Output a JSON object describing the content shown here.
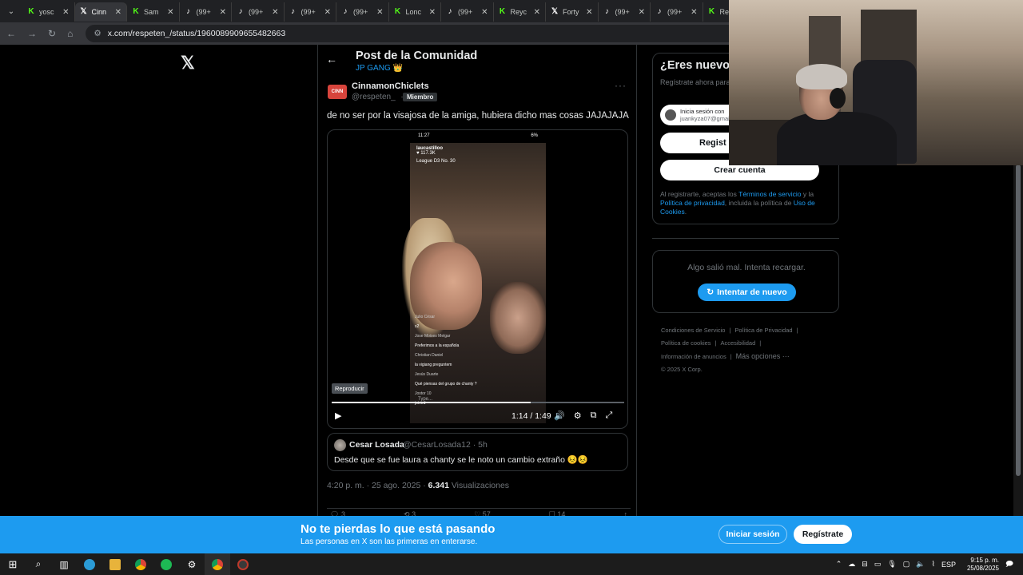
{
  "browser": {
    "tabs": [
      {
        "favicon": "K",
        "favicon_color": "#53fc18",
        "title": "yosc",
        "active": false
      },
      {
        "favicon": "𝕏",
        "favicon_color": "#ffffff",
        "title": "Cinn",
        "active": true
      },
      {
        "favicon": "K",
        "favicon_color": "#53fc18",
        "title": "Sam",
        "active": false
      },
      {
        "favicon": "♪",
        "favicon_color": "#ffffff",
        "title": "(99+",
        "active": false
      },
      {
        "favicon": "♪",
        "favicon_color": "#ffffff",
        "title": "(99+",
        "active": false
      },
      {
        "favicon": "♪",
        "favicon_color": "#ffffff",
        "title": "(99+",
        "active": false
      },
      {
        "favicon": "♪",
        "favicon_color": "#ffffff",
        "title": "(99+",
        "active": false
      },
      {
        "favicon": "K",
        "favicon_color": "#53fc18",
        "title": "Lonc",
        "active": false
      },
      {
        "favicon": "♪",
        "favicon_color": "#ffffff",
        "title": "(99+",
        "active": false
      },
      {
        "favicon": "K",
        "favicon_color": "#53fc18",
        "title": "Reyc",
        "active": false
      },
      {
        "favicon": "𝕏",
        "favicon_color": "#ffffff",
        "title": "Forty",
        "active": false
      },
      {
        "favicon": "♪",
        "favicon_color": "#ffffff",
        "title": "(99+",
        "active": false
      },
      {
        "favicon": "♪",
        "favicon_color": "#ffffff",
        "title": "(99+",
        "active": false
      },
      {
        "favicon": "K",
        "favicon_color": "#53fc18",
        "title": "Reyc",
        "active": false
      }
    ],
    "url": "x.com/respeten_/status/1960089909655482663"
  },
  "header": {
    "title": "Post de la Comunidad",
    "community": "JP GANG 👑"
  },
  "post": {
    "author_name": "CinnamonChiclets",
    "author_handle": "@respeten_",
    "separator": "·",
    "member_badge": "Miembro",
    "text": "de no ser por la visajosa de la amiga, hubiera dicho mas cosas JAJAJAJA",
    "video": {
      "tooltip": "Reproducir",
      "time": "1:14 / 1:49",
      "progress": 0.68,
      "phone_time": "11:27",
      "phone_battery": "6%",
      "live_host": "laucastilloo",
      "live_viewers": "♥ 117.3K",
      "live_rank": "League D3 No. 30",
      "chat": [
        {
          "user": "Julio César",
          "msg": "x2"
        },
        {
          "user": "Jose Moises Melgar",
          "msg": "Preferimos a la española"
        },
        {
          "user": "Christian Daniel",
          "msg": "la vigiang preguntem"
        },
        {
          "user": "Jesús Duarte",
          "msg": "Qué piensas del grupo de chanty ?"
        },
        {
          "user": "Jostor 10",
          "msg": "joined"
        }
      ],
      "chat_input": "Type..."
    },
    "quote": {
      "author_name": "Cesar Losada",
      "author_handle": "@CesarLosada12",
      "age": "5h",
      "text": "Desde que se fue laura a chanty se le noto un cambio extraño 😣😣"
    },
    "timestamp": "4:20 p. m. · 25 ago. 2025 · ",
    "views_count": "6.341",
    "views_label": " Visualizaciones",
    "stats": {
      "replies": "3",
      "reposts": "3",
      "likes": "57",
      "bookmarks": "14"
    }
  },
  "sidebar": {
    "signup_title": "¿Eres nuevo e",
    "signup_desc": "Regístrate ahora para personalizada.",
    "google_line1": "Inicia sesión con",
    "google_line2": "juankyza07@gmail",
    "apple_label": "Regist",
    "create_label": "Crear cuenta",
    "legal_pre": "Al registrarte, aceptas los ",
    "legal_terms": "Términos de servicio",
    "legal_mid": " y la ",
    "legal_privacy": "Política de privacidad",
    "legal_mid2": ", incluida la política de ",
    "legal_cookies": "Uso de Cookies",
    "legal_end": ".",
    "error_text": "Algo salió mal. Intenta recargar.",
    "retry_label": "Intentar de nuevo",
    "footer": {
      "terms": "Condiciones de Servicio",
      "privacy": "Política de Privacidad",
      "cookies": "Política de cookies",
      "accessibility": "Accesibilidad",
      "ads": "Información de anuncios",
      "more": "Más opciones ···",
      "copyright": "© 2025 X Corp."
    }
  },
  "banner": {
    "title": "No te pierdas lo que está pasando",
    "subtitle": "Las personas en X son las primeras en enterarse.",
    "login": "Iniciar sesión",
    "register": "Regístrate"
  },
  "taskbar": {
    "lang": "ESP",
    "time": "9:15 p. m.",
    "date": "25/08/2025"
  },
  "colors": {
    "accent": "#1d9bf0",
    "background": "#000000",
    "border": "#2f3336",
    "muted": "#71767b"
  }
}
